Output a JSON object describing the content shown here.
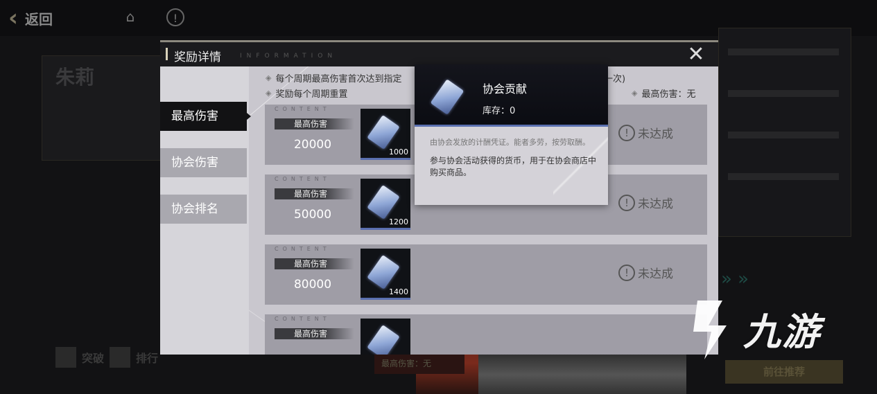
{
  "background": {
    "back_label": "返回",
    "char_name": "朱莉",
    "bottom_tabs": [
      "突破",
      "排行"
    ],
    "bottom_center": "最高伤害：无",
    "go_button": "前往推荐"
  },
  "watermark": {
    "text": "九游"
  },
  "modal": {
    "title": "奖励详情",
    "subtitle": "INFORMATION",
    "close_icon": "close-icon",
    "tabs": [
      {
        "label": "最高伤害",
        "active": true
      },
      {
        "label": "协会伤害",
        "active": false
      },
      {
        "label": "协会排名",
        "active": false
      }
    ],
    "notes": {
      "line1_start": "每个周期最高伤害首次达到指定",
      "line1_end": "一次)",
      "line2": "奖励每个周期重置",
      "best_damage": "最高伤害：无"
    },
    "rows": [
      {
        "content_label": "CONTENT",
        "label": "最高伤害",
        "value": "20000",
        "qty": "1000",
        "status": "未达成"
      },
      {
        "content_label": "CONTENT",
        "label": "最高伤害",
        "value": "50000",
        "qty": "1200",
        "status": "未达成"
      },
      {
        "content_label": "CONTENT",
        "label": "最高伤害",
        "value": "80000",
        "qty": "1400",
        "status": "未达成"
      },
      {
        "content_label": "CONTENT",
        "label": "最高伤害",
        "value": "",
        "qty": "",
        "status": ""
      }
    ]
  },
  "tooltip": {
    "name": "协会贡献",
    "stock": "库存：0",
    "flavor": "由协会发放的计酬凭证。能者多劳，按劳取酬。",
    "description": "参与协会活动获得的货币，用于在协会商店中购买商品。"
  }
}
